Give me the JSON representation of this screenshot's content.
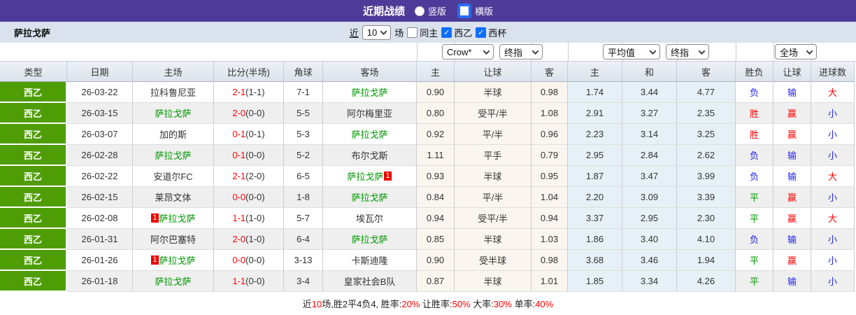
{
  "topbar": {
    "title": "近期战绩",
    "radios": [
      {
        "label": "竖版",
        "selected": false
      },
      {
        "label": "横版",
        "selected": true
      }
    ]
  },
  "subbar": {
    "team": "萨拉戈萨",
    "near_label": "近",
    "matches_select": "10",
    "matches_suffix": "场",
    "checkboxes": [
      {
        "label": "同主",
        "checked": false
      },
      {
        "label": "西乙",
        "checked": true
      },
      {
        "label": "西杯",
        "checked": true
      }
    ]
  },
  "filters": {
    "bookmaker": "Crow*",
    "asian_stage": "终指",
    "euro_mode": "平均值",
    "euro_stage": "终指",
    "scope": "全场"
  },
  "colors": {
    "topbar": "#4c3b98",
    "subbar": "#dae2ee",
    "league_green": "#4f9d05",
    "team_green": "#009900",
    "score_red": "#ff0000",
    "result_red": "#ff0000",
    "result_blue": "#2222ee",
    "result_green": "#009900"
  },
  "table": {
    "headers": [
      "类型",
      "日期",
      "主场",
      "比分(半场)",
      "角球",
      "客场",
      "主",
      "让球",
      "客",
      "主",
      "和",
      "客",
      "胜负",
      "让球",
      "进球数"
    ],
    "rows": [
      {
        "league": "西乙",
        "date": "26-03-22",
        "home": {
          "name": "拉科鲁尼亚",
          "green": false,
          "badge": null
        },
        "score": {
          "ft": "2-1",
          "ht": "(1-1)"
        },
        "corner": "7-1",
        "away": {
          "name": "萨拉戈萨",
          "green": true,
          "badge": null
        },
        "ah_home": "0.90",
        "ah_line": "半球",
        "ah_away": "0.98",
        "eu_home": "1.74",
        "eu_draw": "3.44",
        "eu_away": "4.77",
        "wdl": {
          "t": "负",
          "c": "blue"
        },
        "ah_res": {
          "t": "输",
          "c": "blue"
        },
        "ou_res": {
          "t": "大",
          "c": "red"
        }
      },
      {
        "league": "西乙",
        "date": "26-03-15",
        "home": {
          "name": "萨拉戈萨",
          "green": true,
          "badge": null
        },
        "score": {
          "ft": "2-0",
          "ht": "(0-0)"
        },
        "corner": "5-5",
        "away": {
          "name": "阿尔梅里亚",
          "green": false,
          "badge": null
        },
        "ah_home": "0.80",
        "ah_line": "受平/半",
        "ah_away": "1.08",
        "eu_home": "2.91",
        "eu_draw": "3.27",
        "eu_away": "2.35",
        "wdl": {
          "t": "胜",
          "c": "red"
        },
        "ah_res": {
          "t": "赢",
          "c": "red"
        },
        "ou_res": {
          "t": "小",
          "c": "blue"
        }
      },
      {
        "league": "西乙",
        "date": "26-03-07",
        "home": {
          "name": "加的斯",
          "green": false,
          "badge": null
        },
        "score": {
          "ft": "0-1",
          "ht": "(0-1)"
        },
        "corner": "5-3",
        "away": {
          "name": "萨拉戈萨",
          "green": true,
          "badge": null
        },
        "ah_home": "0.92",
        "ah_line": "平/半",
        "ah_away": "0.96",
        "eu_home": "2.23",
        "eu_draw": "3.14",
        "eu_away": "3.25",
        "wdl": {
          "t": "胜",
          "c": "red"
        },
        "ah_res": {
          "t": "赢",
          "c": "red"
        },
        "ou_res": {
          "t": "小",
          "c": "blue"
        }
      },
      {
        "league": "西乙",
        "date": "26-02-28",
        "home": {
          "name": "萨拉戈萨",
          "green": true,
          "badge": null
        },
        "score": {
          "ft": "0-1",
          "ht": "(0-0)"
        },
        "corner": "5-2",
        "away": {
          "name": "布尔戈斯",
          "green": false,
          "badge": null
        },
        "ah_home": "1.11",
        "ah_line": "平手",
        "ah_away": "0.79",
        "eu_home": "2.95",
        "eu_draw": "2.84",
        "eu_away": "2.62",
        "wdl": {
          "t": "负",
          "c": "blue"
        },
        "ah_res": {
          "t": "输",
          "c": "blue"
        },
        "ou_res": {
          "t": "小",
          "c": "blue"
        }
      },
      {
        "league": "西乙",
        "date": "26-02-22",
        "home": {
          "name": "安道尔FC",
          "green": false,
          "badge": null
        },
        "score": {
          "ft": "2-1",
          "ht": "(2-0)"
        },
        "corner": "6-5",
        "away": {
          "name": "萨拉戈萨",
          "green": true,
          "badge": {
            "pos": "after",
            "text": "1"
          }
        },
        "ah_home": "0.93",
        "ah_line": "半球",
        "ah_away": "0.95",
        "eu_home": "1.87",
        "eu_draw": "3.47",
        "eu_away": "3.99",
        "wdl": {
          "t": "负",
          "c": "blue"
        },
        "ah_res": {
          "t": "输",
          "c": "blue"
        },
        "ou_res": {
          "t": "大",
          "c": "red"
        }
      },
      {
        "league": "西乙",
        "date": "26-02-15",
        "home": {
          "name": "莱昂文体",
          "green": false,
          "badge": null
        },
        "score": {
          "ft": "0-0",
          "ht": "(0-0)"
        },
        "corner": "1-8",
        "away": {
          "name": "萨拉戈萨",
          "green": true,
          "badge": null
        },
        "ah_home": "0.84",
        "ah_line": "平/半",
        "ah_away": "1.04",
        "eu_home": "2.20",
        "eu_draw": "3.09",
        "eu_away": "3.39",
        "wdl": {
          "t": "平",
          "c": "green"
        },
        "ah_res": {
          "t": "赢",
          "c": "red"
        },
        "ou_res": {
          "t": "小",
          "c": "blue"
        }
      },
      {
        "league": "西乙",
        "date": "26-02-08",
        "home": {
          "name": "萨拉戈萨",
          "green": true,
          "badge": {
            "pos": "before",
            "text": "1"
          }
        },
        "score": {
          "ft": "1-1",
          "ht": "(1-0)"
        },
        "corner": "5-7",
        "away": {
          "name": "埃瓦尔",
          "green": false,
          "badge": null
        },
        "ah_home": "0.94",
        "ah_line": "受平/半",
        "ah_away": "0.94",
        "eu_home": "3.37",
        "eu_draw": "2.95",
        "eu_away": "2.30",
        "wdl": {
          "t": "平",
          "c": "green"
        },
        "ah_res": {
          "t": "赢",
          "c": "red"
        },
        "ou_res": {
          "t": "大",
          "c": "red"
        }
      },
      {
        "league": "西乙",
        "date": "26-01-31",
        "home": {
          "name": "阿尔巴塞特",
          "green": false,
          "badge": null
        },
        "score": {
          "ft": "2-0",
          "ht": "(1-0)"
        },
        "corner": "6-4",
        "away": {
          "name": "萨拉戈萨",
          "green": true,
          "badge": null
        },
        "ah_home": "0.85",
        "ah_line": "半球",
        "ah_away": "1.03",
        "eu_home": "1.86",
        "eu_draw": "3.40",
        "eu_away": "4.10",
        "wdl": {
          "t": "负",
          "c": "blue"
        },
        "ah_res": {
          "t": "输",
          "c": "blue"
        },
        "ou_res": {
          "t": "小",
          "c": "blue"
        }
      },
      {
        "league": "西乙",
        "date": "26-01-26",
        "home": {
          "name": "萨拉戈萨",
          "green": true,
          "badge": {
            "pos": "before",
            "text": "1"
          }
        },
        "score": {
          "ft": "0-0",
          "ht": "(0-0)"
        },
        "corner": "3-13",
        "away": {
          "name": "卡斯迪隆",
          "green": false,
          "badge": null
        },
        "ah_home": "0.90",
        "ah_line": "受半球",
        "ah_away": "0.98",
        "eu_home": "3.68",
        "eu_draw": "3.46",
        "eu_away": "1.94",
        "wdl": {
          "t": "平",
          "c": "green"
        },
        "ah_res": {
          "t": "赢",
          "c": "red"
        },
        "ou_res": {
          "t": "小",
          "c": "blue"
        }
      },
      {
        "league": "西乙",
        "date": "26-01-18",
        "home": {
          "name": "萨拉戈萨",
          "green": true,
          "badge": null
        },
        "score": {
          "ft": "1-1",
          "ht": "(0-0)"
        },
        "corner": "3-4",
        "away": {
          "name": "皇家社会B队",
          "green": false,
          "badge": null
        },
        "ah_home": "0.87",
        "ah_line": "半球",
        "ah_away": "1.01",
        "eu_home": "1.85",
        "eu_draw": "3.34",
        "eu_away": "4.26",
        "wdl": {
          "t": "平",
          "c": "green"
        },
        "ah_res": {
          "t": "输",
          "c": "blue"
        },
        "ou_res": {
          "t": "小",
          "c": "blue"
        }
      }
    ]
  },
  "footer": {
    "segments": [
      {
        "t": "近",
        "red": false
      },
      {
        "t": "10",
        "red": true
      },
      {
        "t": "场,胜2平4负4, 胜率:",
        "red": false
      },
      {
        "t": "20%",
        "red": true
      },
      {
        "t": " 让胜率:",
        "red": false
      },
      {
        "t": "50%",
        "red": true
      },
      {
        "t": " 大率:",
        "red": false
      },
      {
        "t": "30%",
        "red": true
      },
      {
        "t": " 单率:",
        "red": false
      },
      {
        "t": "40%",
        "red": true
      }
    ]
  }
}
